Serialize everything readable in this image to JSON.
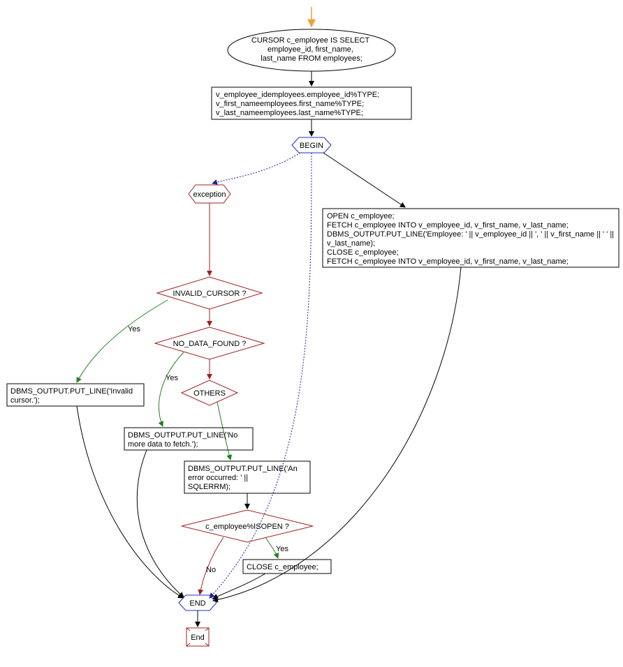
{
  "nodes": {
    "cursor_decl": "CURSOR c_employee IS SELECT\nemployee_id, first_name,\nlast_name FROM employees;",
    "var_decl": "v_employee_idemployees.employee_id%TYPE;\nv_first_nameemployees.first_name%TYPE;\nv_last_nameemployees.last_name%TYPE;",
    "begin": "BEGIN",
    "exception": "exception",
    "body_block": "OPEN c_employee;\nFETCH c_employee INTO v_employee_id, v_first_name, v_last_name;\nDBMS_OUTPUT.PUT_LINE('Employee: ' || v_employee_id || ', ' || v_first_name || ' ' ||\nv_last_name);\nCLOSE c_employee;\nFETCH c_employee INTO v_employee_id, v_first_name, v_last_name;",
    "invalid_cursor": "INVALID_CURSOR ?",
    "no_data_found": "NO_DATA_FOUND ?",
    "others": "OTHERS",
    "invalid_out": "DBMS_OUTPUT.PUT_LINE('Invalid\ncursor.');",
    "nodata_out": "DBMS_OUTPUT.PUT_LINE('No\nmore data to fetch.');",
    "error_out": "DBMS_OUTPUT.PUT_LINE('An\nerror occurred: ' ||\nSQLERRM);",
    "isopen": "c_employee%ISOPEN ?",
    "close": "CLOSE c_employee;",
    "end": "END",
    "terminal": "End"
  },
  "labels": {
    "yes": "Yes",
    "no": "No"
  }
}
